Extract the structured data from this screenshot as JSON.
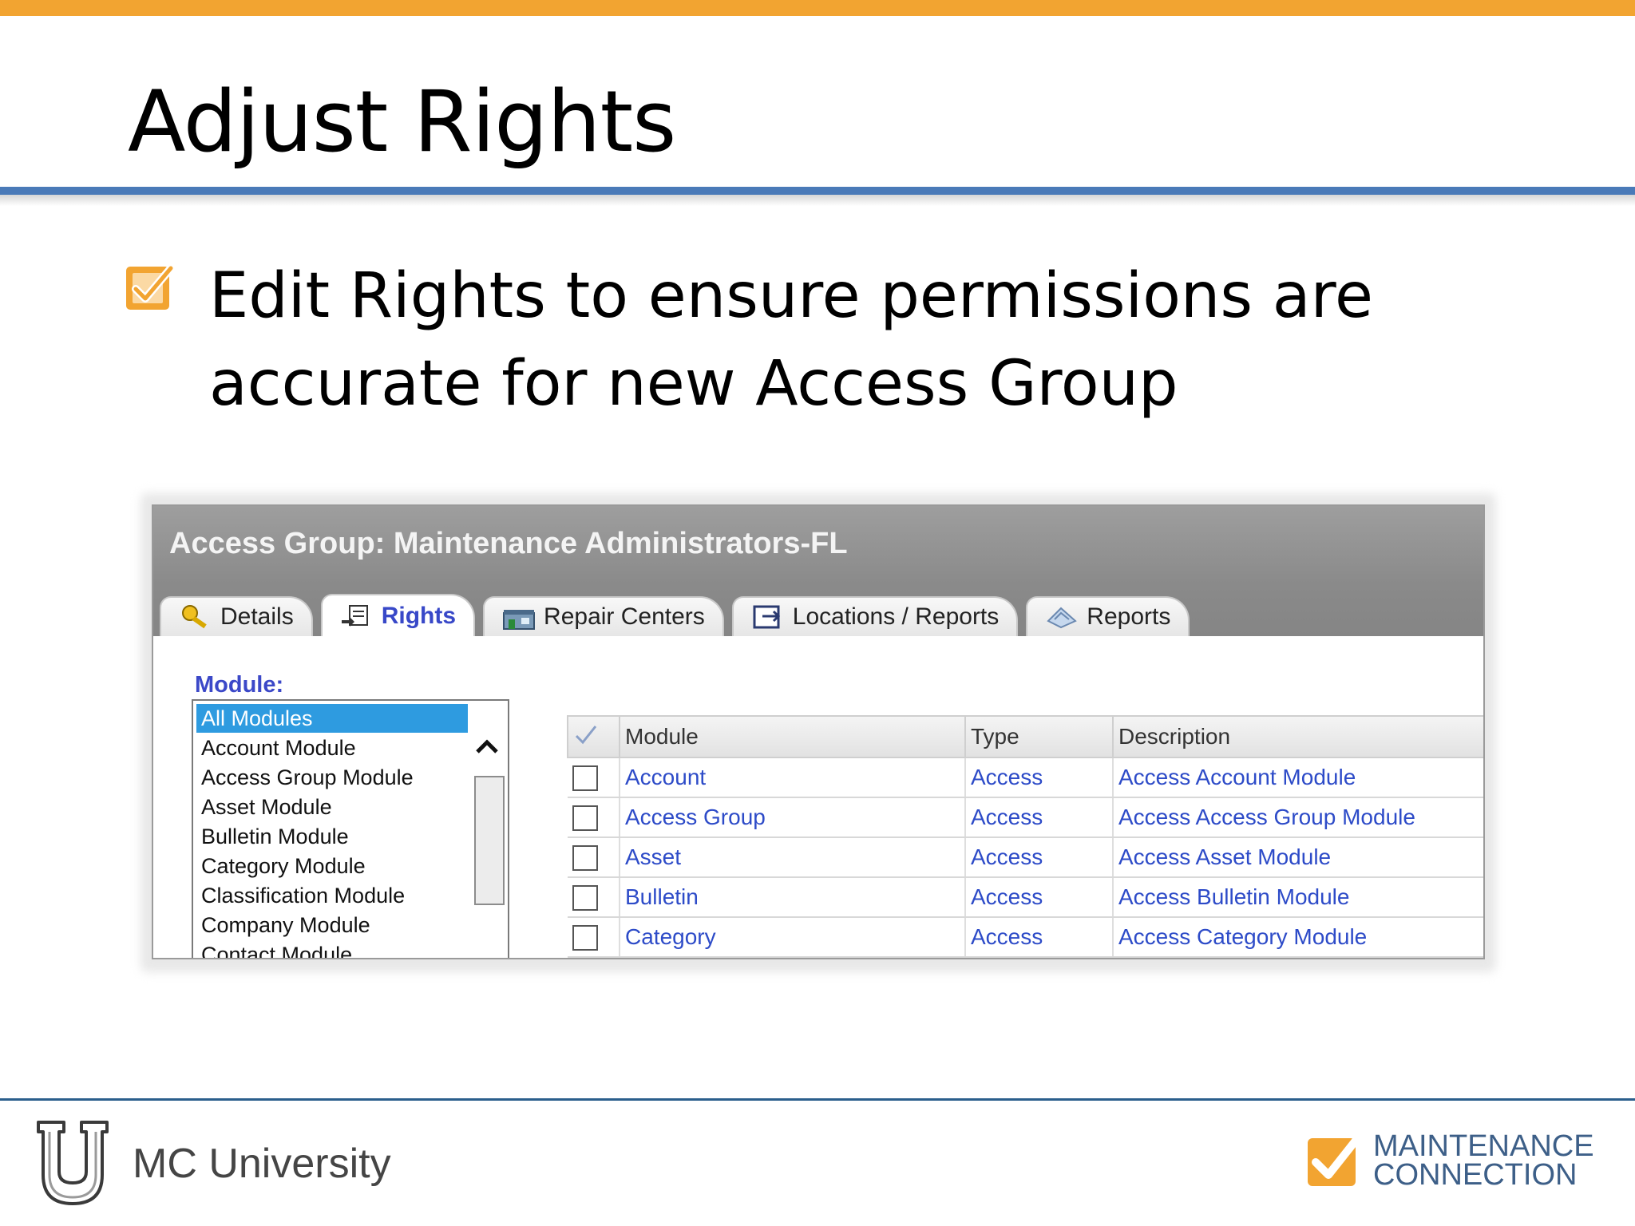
{
  "slide": {
    "title": "Adjust Rights",
    "bullet": "Edit Rights to ensure permissions are accurate for new Access Group"
  },
  "screenshot": {
    "window_title": "Access Group: Maintenance Administrators-FL",
    "tabs": [
      {
        "label": "Details",
        "icon": "key-search-icon",
        "active": false
      },
      {
        "label": "Rights",
        "icon": "rights-icon",
        "active": true
      },
      {
        "label": "Repair Centers",
        "icon": "building-icon",
        "active": false
      },
      {
        "label": "Locations / Reports",
        "icon": "location-icon",
        "active": false
      },
      {
        "label": "Reports",
        "icon": "reports-icon",
        "active": false
      }
    ],
    "module_label": "Module:",
    "module_list": [
      "All Modules",
      "Account Module",
      "Access Group Module",
      "Asset Module",
      "Bulletin Module",
      "Category Module",
      "Classification Module",
      "Company Module",
      "Contact Module"
    ],
    "selected_module": "All Modules",
    "grid_headers": [
      "Module",
      "Type",
      "Description"
    ],
    "grid_rows": [
      {
        "module": "Account",
        "type": "Access",
        "description": "Access Account Module"
      },
      {
        "module": "Access Group",
        "type": "Access",
        "description": "Access Access Group Module"
      },
      {
        "module": "Asset",
        "type": "Access",
        "description": "Access Asset Module"
      },
      {
        "module": "Bulletin",
        "type": "Access",
        "description": "Access Bulletin Module"
      },
      {
        "module": "Category",
        "type": "Access",
        "description": "Access Category Module"
      }
    ]
  },
  "footer": {
    "university": "MC University",
    "brand_line1": "MAINTENANCE",
    "brand_line2": "CONNECTION"
  },
  "colors": {
    "accent_orange": "#f2a431",
    "rule_blue": "#4a7ab8",
    "link_blue": "#2d4bc8",
    "selection_blue": "#2e9be0"
  }
}
